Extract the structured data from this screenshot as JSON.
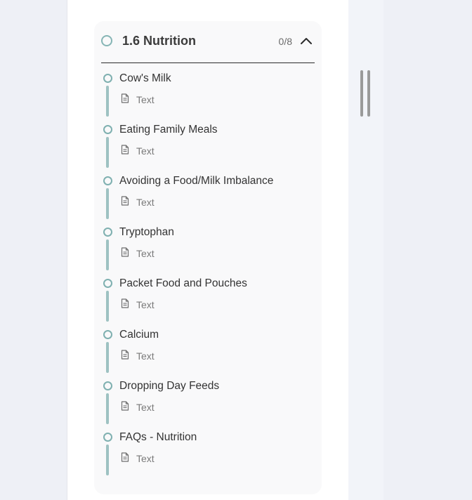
{
  "section": {
    "title": "1.6 Nutrition",
    "progress": "0/8",
    "expanded": true,
    "status_icon": "circle-outline-icon",
    "toggle_icon": "chevron-up-icon"
  },
  "lessons": [
    {
      "title": "Cow's Milk",
      "type": "Text",
      "icon": "document-icon"
    },
    {
      "title": "Eating Family Meals",
      "type": "Text",
      "icon": "document-icon"
    },
    {
      "title": "Avoiding a Food/Milk Imbalance",
      "type": "Text",
      "icon": "document-icon"
    },
    {
      "title": "Tryptophan",
      "type": "Text",
      "icon": "document-icon"
    },
    {
      "title": "Packet Food and Pouches",
      "type": "Text",
      "icon": "document-icon"
    },
    {
      "title": "Calcium",
      "type": "Text",
      "icon": "document-icon"
    },
    {
      "title": "Dropping Day Feeds",
      "type": "Text",
      "icon": "document-icon"
    },
    {
      "title": "FAQs - Nutrition",
      "type": "Text",
      "icon": "document-icon"
    }
  ],
  "colors": {
    "accent_ring": "#86b5b5",
    "connector": "#9ec2c2",
    "card_background": "#f9f9fa",
    "page_background": "#eef0f6"
  }
}
